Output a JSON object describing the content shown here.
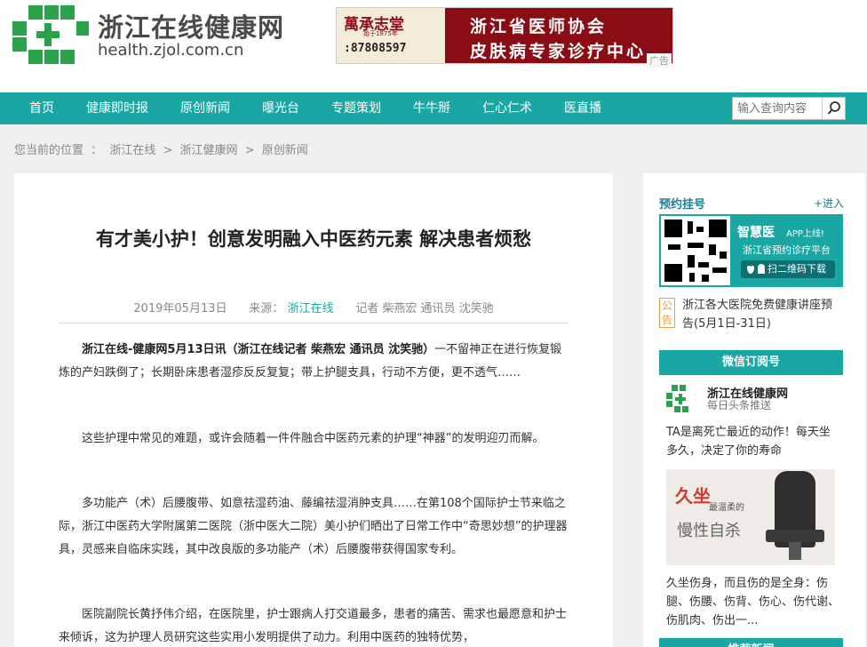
{
  "site": {
    "title": "浙江在线健康网",
    "url": "health.zjol.com.cn"
  },
  "ad": {
    "brand": "萬承志堂",
    "brand_sub": "始于1875年",
    "phone": ":87808597",
    "line1": "浙江省医师协会",
    "line2": "皮肤病专家诊疗中心",
    "tag": "广告"
  },
  "nav": {
    "items": [
      "首页",
      "健康即时报",
      "原创新闻",
      "曝光台",
      "专题策划",
      "牛牛掰",
      "仁心仁术",
      "医直播"
    ],
    "search_placeholder": "输入查询内容"
  },
  "breadcrumb": {
    "prefix": "您当前的位置",
    "sep1": "：",
    "item1": "浙江在线",
    "sep2": ">",
    "item2": "浙江健康网",
    "sep3": ">",
    "item3": "原创新闻"
  },
  "article": {
    "title": "有才美小护！创意发明融入中医药元素 解决患者烦愁",
    "date": "2019年05月13日",
    "source_label": "来源：",
    "source": "浙江在线",
    "authors": "记者 柴燕宏 通讯员 沈笑驰",
    "p1_lead": "浙江在线-健康网5月13日讯（浙江在线记者 柴燕宏 通讯员 沈笑驰）",
    "p1_body": "一不留神正在进行恢复锻炼的产妇跌倒了；长期卧床患者湿疹反反复复；带上护腿支具，行动不方便，更不透气……",
    "p2": "这些护理中常见的难题，或许会随着一件件融合中医药元素的护理“神器”的发明迎刃而解。",
    "p3": "多功能产（术）后腰腹带、如意祛湿药油、藤编祛湿消肿支具……在第108个国际护士节来临之际，浙江中医药大学附属第二医院（浙中医大二院）美小护们晒出了日常工作中“奇思妙想”的护理器具，灵感来自临床实践，其中改良版的多功能产（术）后腰腹带获得国家专利。",
    "p4": "医院副院长黄抒伟介绍，在医院里，护士跟病人打交道最多，患者的痛苦、需求也最愿意和护士来倾诉，这为护理人员研究这些实用小发明提供了动力。利用中医药的独特优势，"
  },
  "sidebar": {
    "appt_title": "预约挂号",
    "appt_more": "+进入",
    "app_name": "智慧医",
    "app_tag": "APP上线!",
    "app_sub": "浙江省预约诊疗平台",
    "app_dl": "扫二维码下载",
    "notice_tag": "公告",
    "notice_text": "浙江各大医院免费健康讲座预告(5月1日-31日)",
    "wechat_head": "微信订阅号",
    "wechat_name": "浙江在线健康网",
    "wechat_sub": "每日头条推送",
    "story1_title": "TA是离死亡最近的动作！每天坐多久，决定了你的寿命",
    "story1_img_t1": "久坐",
    "story1_img_t2": "最温柔的",
    "story1_img_t3": "慢性自杀",
    "story1_desc": "久坐伤身，而且伤的是全身：伤腿、伤腰、伤背、伤心、伤代谢、伤肌肉、伤出一...",
    "next_head": "推荐新闻"
  },
  "colors": {
    "accent": "#1aa7a3",
    "logo_green": "#29a24a",
    "ad_red": "#8a0d16"
  }
}
